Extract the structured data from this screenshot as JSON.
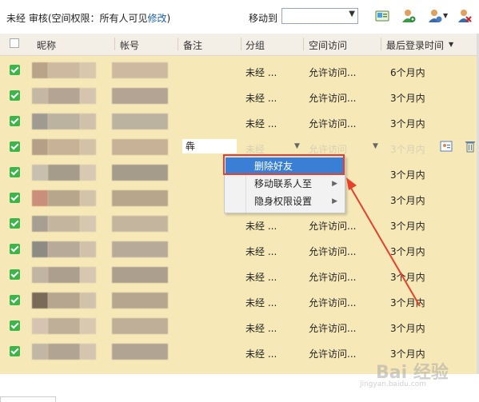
{
  "toolbar": {
    "title_prefix": "未经 审核(空间权限：所有人可见",
    "title_link": "修改",
    "title_suffix": ")",
    "moveto_label": "移动到",
    "moveto_value": ""
  },
  "columns": {
    "nickname": "昵称",
    "account": "帐号",
    "remark": "备注",
    "group": "分组",
    "access": "空间访问",
    "last_login": "最后登录时间"
  },
  "rows": [
    {
      "group": "未经 ...",
      "access": "允许访问...",
      "last_login": "6个月内"
    },
    {
      "group": "未经 ...",
      "access": "允许访问...",
      "last_login": "3个月内"
    },
    {
      "group": "未经 ...",
      "access": "允许访问...",
      "last_login": "3个月内"
    },
    {
      "group": "未经",
      "access": "允许访问",
      "last_login": "3个月内",
      "remark": "犇"
    },
    {
      "group": "",
      "access": "",
      "last_login": "3个月内"
    },
    {
      "group": "",
      "access": "",
      "last_login": "3个月内"
    },
    {
      "group": "未经 ...",
      "access": "允许访问...",
      "last_login": "3个月内"
    },
    {
      "group": "未经 ...",
      "access": "允许访问...",
      "last_login": "3个月内"
    },
    {
      "group": "未经 ...",
      "access": "允许访问...",
      "last_login": "3个月内"
    },
    {
      "group": "未经 ...",
      "access": "允许访问...",
      "last_login": "3个月内"
    },
    {
      "group": "未经 ...",
      "access": "允许访问...",
      "last_login": "3个月内"
    },
    {
      "group": "未经 ...",
      "access": "允许访问...",
      "last_login": "3个月内"
    }
  ],
  "context_menu": {
    "items": [
      {
        "label": "删除好友",
        "has_submenu": false,
        "highlighted": true
      },
      {
        "label": "移动联系人至",
        "has_submenu": true,
        "highlighted": false
      },
      {
        "label": "隐身权限设置",
        "has_submenu": true,
        "highlighted": false
      }
    ]
  },
  "watermark": {
    "text": "Bai 经验",
    "sub": "jingyan.baidu.com"
  },
  "colors": {
    "row_bg": "#f7e8b8",
    "check": "#3cb64b",
    "menu_highlight": "#3a7fd6",
    "annotation": "#e8412b"
  },
  "icons": [
    "contacts-icon",
    "add-user-icon",
    "user-settings-icon",
    "delete-user-icon",
    "contact-card-icon",
    "trash-icon"
  ]
}
